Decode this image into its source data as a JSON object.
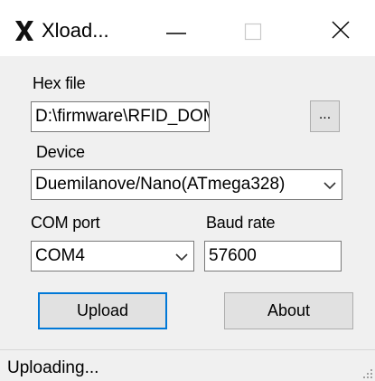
{
  "window": {
    "title": "Xload...",
    "icons": {
      "app": "xload-x-icon",
      "minimize": "minimize-icon",
      "maximize": "maximize-icon",
      "close": "close-icon"
    }
  },
  "hex": {
    "label": "Hex file",
    "value": "D:\\firmware\\RFID_DOMINAT(",
    "browse_label": "..."
  },
  "device": {
    "label": "Device",
    "selected": "Duemilanove/Nano(ATmega328)"
  },
  "com": {
    "label": "COM port",
    "selected": "COM4"
  },
  "baud": {
    "label": "Baud rate",
    "value": "57600"
  },
  "buttons": {
    "upload": "Upload",
    "about": "About"
  },
  "status": {
    "text": "Uploading..."
  },
  "colors": {
    "focus_border": "#0078d7",
    "button_face": "#e1e1e1",
    "window_bg": "#f0f0f0"
  }
}
